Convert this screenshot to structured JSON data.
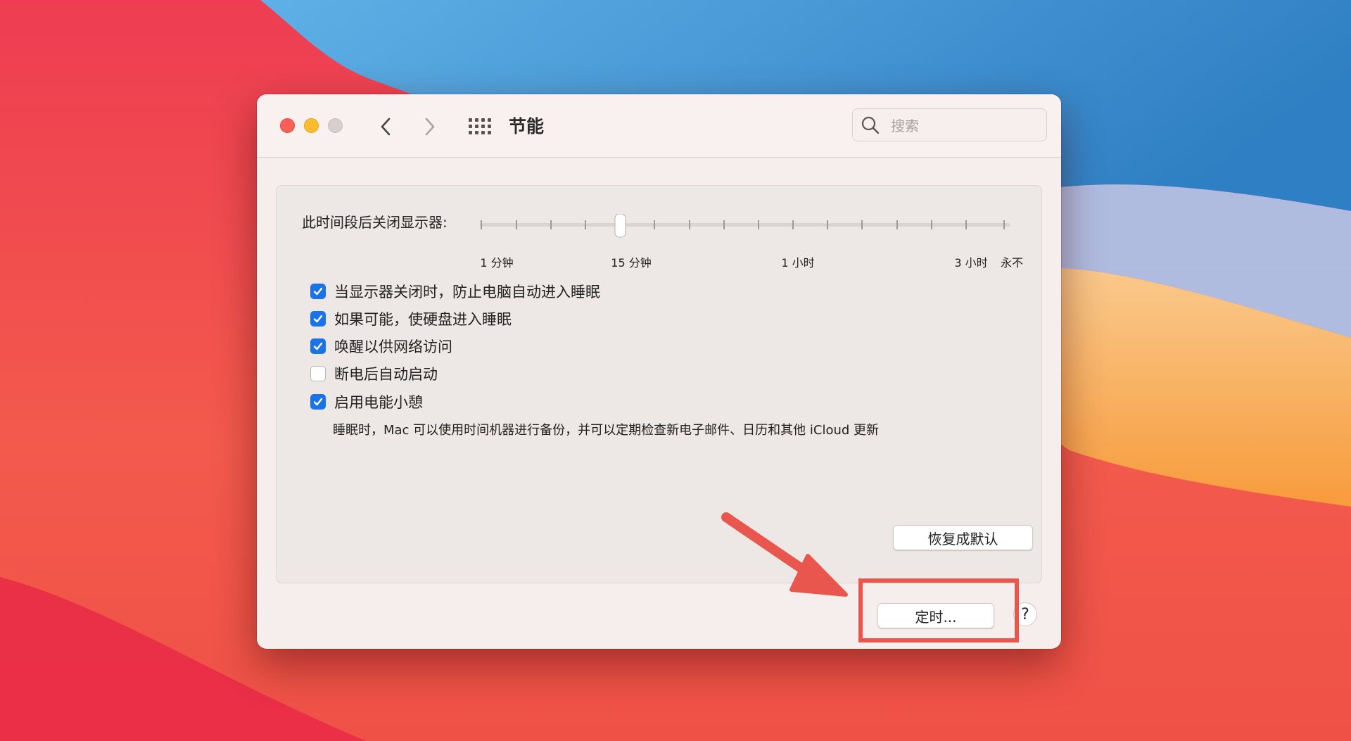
{
  "window": {
    "title": "节能",
    "search": {
      "placeholder": "搜索",
      "value": ""
    }
  },
  "display_sleep": {
    "label": "此时间段后关闭显示器:",
    "value": "15 分钟",
    "ticks": [
      "1 分钟",
      "15 分钟",
      "1 小时",
      "3 小时",
      "永不"
    ]
  },
  "options": [
    {
      "label": "当显示器关闭时，防止电脑自动进入睡眠",
      "checked": true
    },
    {
      "label": "如果可能，使硬盘进入睡眠",
      "checked": true
    },
    {
      "label": "唤醒以供网络访问",
      "checked": true
    },
    {
      "label": "断电后自动启动",
      "checked": false
    },
    {
      "label": "启用电能小憩",
      "checked": true
    }
  ],
  "power_nap_description": "睡眠时，Mac 可以使用时间机器进行备份，并可以定期检查新电子邮件、日历和其他 iCloud 更新",
  "buttons": {
    "restore_defaults": "恢复成默认",
    "schedule": "定时...",
    "help": "?"
  },
  "colors": {
    "accent": "#1a73e8",
    "annotation": "#e8564d"
  }
}
